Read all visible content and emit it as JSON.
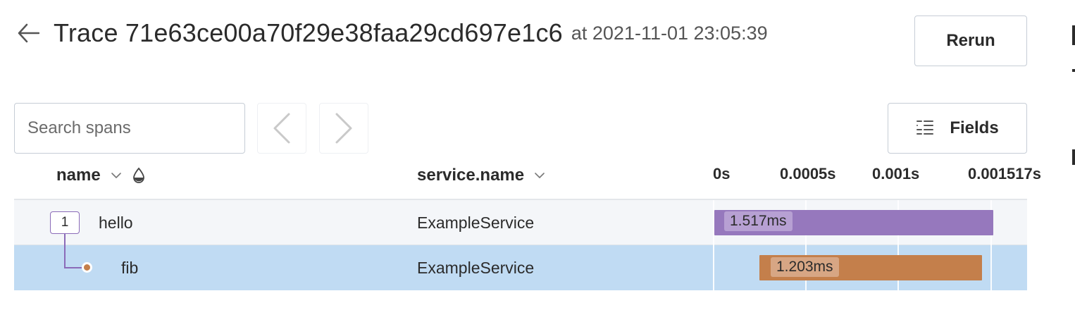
{
  "header": {
    "title": "Trace 71e63ce00a70f29e38faa29cd697e1c6",
    "subtitle": "at 2021-11-01 23:05:39",
    "rerun_label": "Rerun"
  },
  "toolbar": {
    "search_placeholder": "Search spans",
    "fields_label": "Fields"
  },
  "columns": {
    "name": "name",
    "service": "service.name"
  },
  "timeline": {
    "ticks": [
      "0s",
      "0.0005s",
      "0.001s",
      "0.001517s"
    ],
    "total_duration_s": 0.001517
  },
  "spans": [
    {
      "count": "1",
      "name": "hello",
      "service": "ExampleService",
      "duration_label": "1.517ms",
      "start_s": 0.0,
      "duration_s": 0.001517,
      "color": "#9678bd",
      "selected": false
    },
    {
      "name": "fib",
      "service": "ExampleService",
      "duration_label": "1.203ms",
      "start_s": 0.000245,
      "duration_s": 0.001203,
      "color": "#c47f4b",
      "selected": true
    }
  ],
  "colors": {
    "selected_row": "#c0dbf3",
    "tree_line": "#8b6bb8"
  }
}
